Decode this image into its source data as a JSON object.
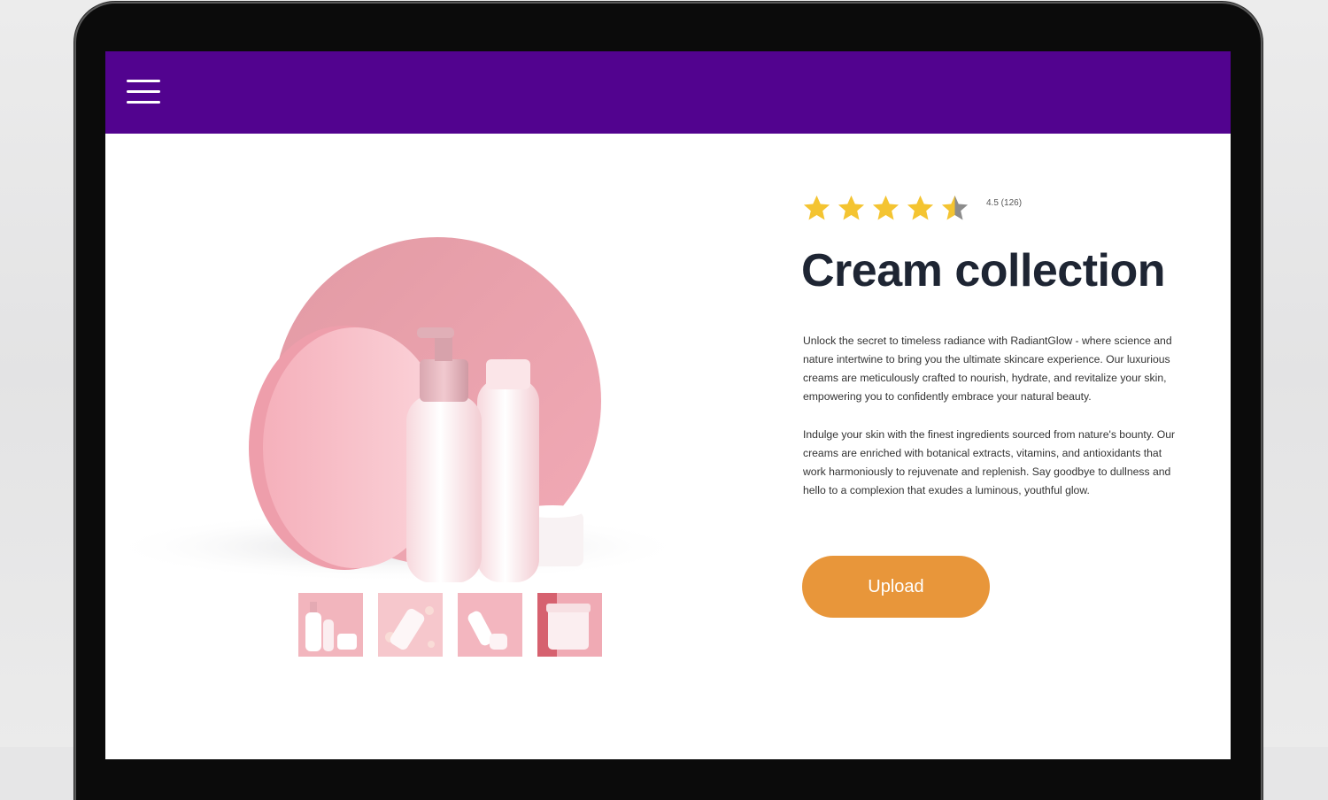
{
  "app": {
    "accent_color": "#52038f",
    "button_color": "#e8963a"
  },
  "header": {
    "menu_icon": "hamburger-menu-icon"
  },
  "gallery": {
    "main_image": "cream-bottles-product-photo",
    "thumbnails": [
      {
        "name": "thumbnail-bottles-jar"
      },
      {
        "name": "thumbnail-tube-petals"
      },
      {
        "name": "thumbnail-pump-jar"
      },
      {
        "name": "thumbnail-jar-closeup"
      }
    ]
  },
  "product": {
    "rating_value": 4.5,
    "rating_text": "4.5 (126)",
    "title": "Cream collection",
    "description_1": "Unlock the secret to timeless radiance with RadiantGlow - where science and nature intertwine to bring you the ultimate skincare experience. Our luxurious creams are meticulously crafted to nourish, hydrate, and revitalize your skin, empowering you to confidently embrace your natural beauty.",
    "description_2": "Indulge your skin with the finest ingredients sourced from nature's bounty. Our creams are enriched with botanical extracts, vitamins, and antioxidants that work harmoniously to rejuvenate and replenish. Say goodbye to dullness and hello to a complexion that exudes a luminous, youthful glow.",
    "button_label": "Upload"
  }
}
